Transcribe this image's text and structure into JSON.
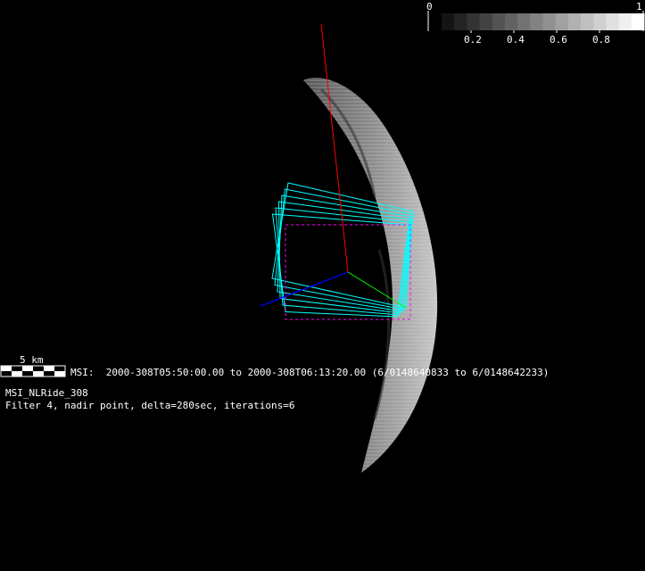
{
  "colorbar": {
    "min_label": "0",
    "max_label": "1",
    "ticks": [
      "0.2",
      "0.4",
      "0.6",
      "0.8"
    ],
    "tick_values": [
      0.2,
      0.4,
      0.6,
      0.8
    ],
    "steps": 16
  },
  "scale_bar": {
    "label": "5 km"
  },
  "info": {
    "msi_line": "MSI:  2000-308T05:50:00.00 to 2000-308T06:13:20.00 (6/0148640833 to 6/0148642233)",
    "title": "MSI_NLRide_308",
    "params": "Filter 4, nadir point, delta=280sec, iterations=6"
  },
  "frames": {
    "count": 6
  },
  "colors": {
    "frame": "#00ffff",
    "nadir_frame": "#ff00ff",
    "axis_x": "#ff0000",
    "axis_y": "#00ff00",
    "axis_z": "#0000ff"
  }
}
